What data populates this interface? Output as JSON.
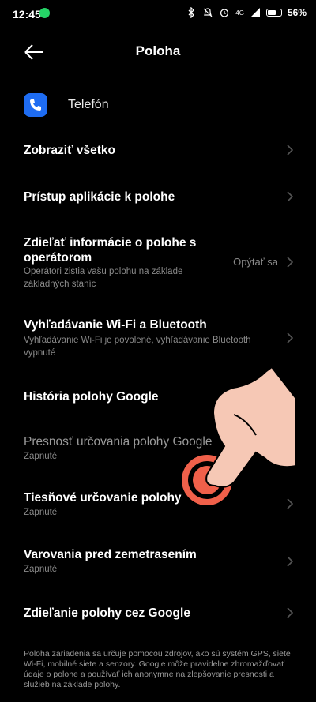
{
  "status_bar": {
    "time": "12:45",
    "network": "4G",
    "battery_text": "56%",
    "battery_level": 0.56,
    "icons": [
      "whatsapp-icon",
      "bluetooth-icon",
      "mute-icon",
      "alarm-icon",
      "signal-icon",
      "battery-icon"
    ]
  },
  "header": {
    "title": "Poloha"
  },
  "app": {
    "name": "Telefón",
    "icon": "phone-icon"
  },
  "rows": [
    {
      "label": "Zobraziť všetko",
      "sub": "",
      "value": ""
    },
    {
      "label": "Prístup aplikácie k polohe",
      "sub": "",
      "value": ""
    },
    {
      "label": "Zdieľať informácie o polohe s operátorom",
      "sub": "Operátori zistia vašu polohu na základe základných staníc",
      "value": "Opýtať sa"
    },
    {
      "label": "Vyhľadávanie Wi-Fi a Bluetooth",
      "sub": "Vyhľadávanie Wi-Fi je povolené, vyhľadávanie Bluetooth vypnuté",
      "value": ""
    },
    {
      "label": "História polohy Google",
      "sub": "",
      "value": ""
    },
    {
      "label": "Presnosť určovania polohy Google",
      "sub": "Zapnuté",
      "value": ""
    },
    {
      "label": "Tiesňové určovanie polohy",
      "sub": "Zapnuté",
      "value": ""
    },
    {
      "label": "Varovania pred zemetrasením",
      "sub": "Zapnuté",
      "value": ""
    },
    {
      "label": "Zdieľanie polohy cez Google",
      "sub": "",
      "value": ""
    }
  ],
  "footer": "Poloha zariadenia sa určuje pomocou zdrojov, ako sú systém GPS, siete Wi-Fi, mobilné siete a senzory. Google môže pravidelne zhromažďovať údaje o polohe a používať ich anonymne na zlepšovanie presnosti a služieb na základe polohy.",
  "colors": {
    "background": "#000000",
    "accent": "#1e6cf2",
    "secondary_text": "#8a8a8a",
    "tap_indicator": "#f0604a"
  }
}
